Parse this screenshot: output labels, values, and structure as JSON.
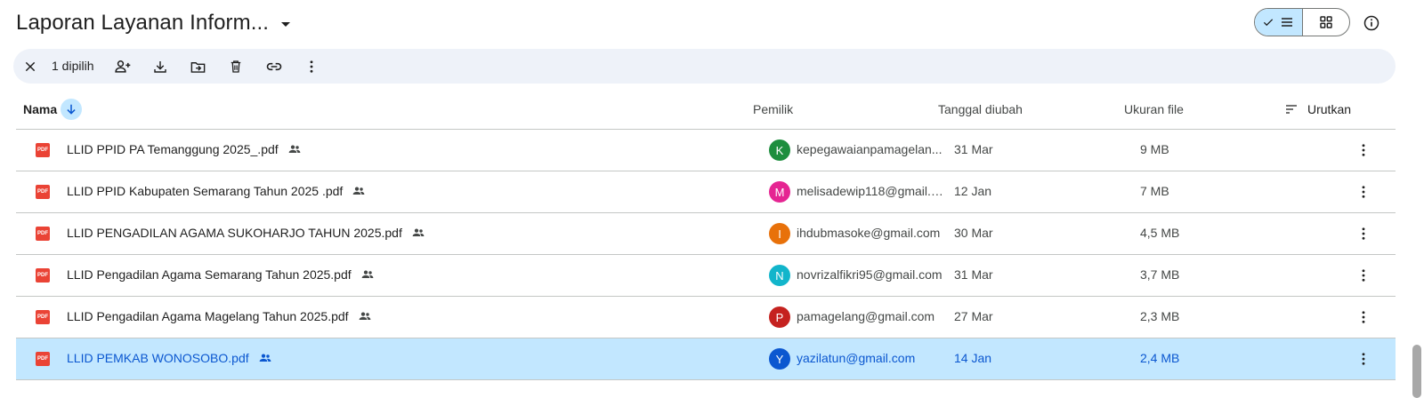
{
  "header": {
    "title": "Laporan Layanan Inform...",
    "view_list": "list-view",
    "view_grid": "grid-view"
  },
  "selection_bar": {
    "count_label": "1 dipilih"
  },
  "columns": {
    "name": "Nama",
    "owner": "Pemilik",
    "modified": "Tanggal diubah",
    "size": "Ukuran file",
    "sort": "Urutkan"
  },
  "files": [
    {
      "name": "LLID PPID PA Temanggung 2025_.pdf",
      "avatar": "K",
      "avatar_color": "#1e8e3e",
      "owner": "kepegawaianpamagelan...",
      "date": "31 Mar",
      "size": "9 MB"
    },
    {
      "name": "LLID PPID Kabupaten Semarang Tahun 2025 .pdf",
      "avatar": "M",
      "avatar_color": "#e52592",
      "owner": "melisadewip118@gmail.c...",
      "date": "12 Jan",
      "size": "7 MB"
    },
    {
      "name": "LLID PENGADILAN AGAMA SUKOHARJO TAHUN 2025.pdf",
      "avatar": "I",
      "avatar_color": "#e8710a",
      "owner": "ihdubmasoke@gmail.com",
      "date": "30 Mar",
      "size": "4,5 MB"
    },
    {
      "name": "LLID Pengadilan Agama Semarang Tahun 2025.pdf",
      "avatar": "N",
      "avatar_color": "#12b5cb",
      "owner": "novrizalfikri95@gmail.com",
      "date": "31 Mar",
      "size": "3,7 MB"
    },
    {
      "name": "LLID Pengadilan Agama Magelang Tahun 2025.pdf",
      "avatar": "P",
      "avatar_color": "#c5221f",
      "owner": "pamagelang@gmail.com",
      "date": "27 Mar",
      "size": "2,3 MB"
    },
    {
      "name": "LLID PEMKAB WONOSOBO.pdf",
      "avatar": "Y",
      "avatar_color": "#0b57d0",
      "owner": "yazilatun@gmail.com",
      "date": "14 Jan",
      "size": "2,4 MB",
      "selected": true
    }
  ],
  "colors": {
    "accent": "#0b57d0",
    "selected_bg": "#c2e7ff",
    "toolbar_bg": "#eef2f9",
    "pdf_red": "#ea4335"
  },
  "icons": {
    "pdf_badge": "PDF"
  }
}
